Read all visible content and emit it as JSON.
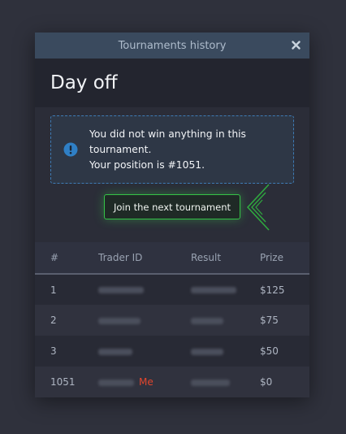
{
  "modal": {
    "header_title": "Tournaments history",
    "close_icon": "close-icon",
    "title": "Day off"
  },
  "notice": {
    "icon": "info-icon",
    "line1": "You did not win anything in this",
    "line2": "tournament.",
    "line3": "Your position is #1051."
  },
  "cta": {
    "label": "Join the next tournament"
  },
  "table": {
    "headers": [
      "#",
      "Trader ID",
      "Result",
      "Prize"
    ],
    "rows": [
      {
        "rank": "1",
        "prize": "$125"
      },
      {
        "rank": "2",
        "prize": "$75"
      },
      {
        "rank": "3",
        "prize": "$50"
      },
      {
        "rank": "1051",
        "me": "Me",
        "prize": "$0"
      }
    ]
  },
  "colors": {
    "accent_green": "#35c247",
    "info_blue": "#3e7bb5",
    "me_red": "#e2462d"
  }
}
